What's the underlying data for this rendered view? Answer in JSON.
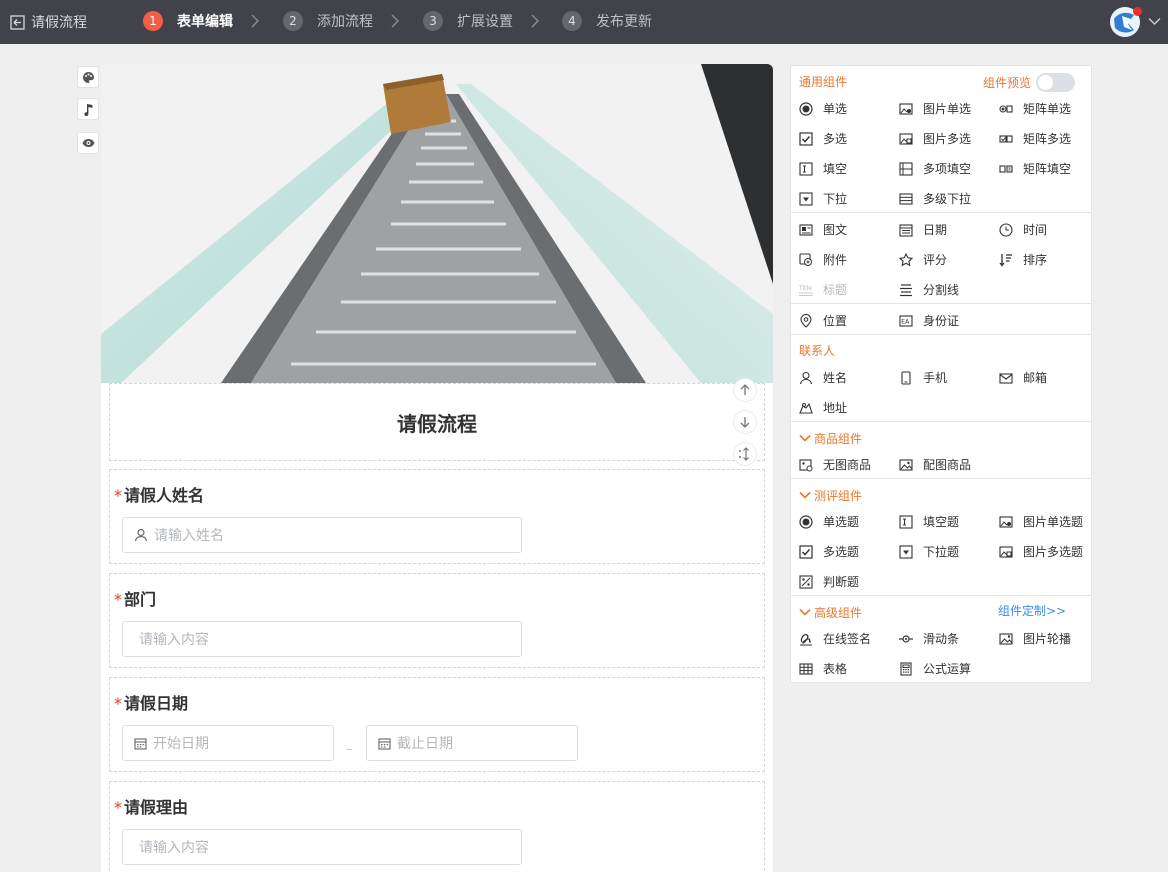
{
  "topbar": {
    "back_label": "请假流程",
    "steps": [
      {
        "num": "1",
        "label": "表单编辑",
        "active": true
      },
      {
        "num": "2",
        "label": "添加流程"
      },
      {
        "num": "3",
        "label": "扩展设置"
      },
      {
        "num": "4",
        "label": "发布更新"
      }
    ],
    "accent": "#f45e49"
  },
  "tools": [
    "palette-icon",
    "music-icon",
    "eye-icon"
  ],
  "form": {
    "title": "请假流程",
    "fields": [
      {
        "label": "请假人姓名",
        "placeholder": "请输入姓名"
      },
      {
        "label": "部门",
        "placeholder": "请输入内容"
      },
      {
        "label": "请假日期",
        "start_placeholder": "开始日期",
        "end_placeholder": "截止日期",
        "separator": "–"
      },
      {
        "label": "请假理由",
        "placeholder": "请输入内容"
      }
    ],
    "required_mark": "*"
  },
  "panel": {
    "general": {
      "title": "通用组件",
      "preview_label": "组件预览",
      "items": [
        "单选",
        "图片单选",
        "矩阵单选",
        "多选",
        "图片多选",
        "矩阵多选",
        "填空",
        "多项填空",
        "矩阵填空",
        "下拉",
        "多级下拉"
      ]
    },
    "group2": {
      "items": [
        "图文",
        "日期",
        "时间",
        "附件",
        "评分",
        "排序",
        "标题",
        "分割线"
      ]
    },
    "group3": {
      "items": [
        "位置",
        "身份证"
      ]
    },
    "contact": {
      "title": "联系人",
      "items": [
        "姓名",
        "手机",
        "邮箱",
        "地址"
      ]
    },
    "goods": {
      "title": "商品组件",
      "items": [
        "无图商品",
        "配图商品"
      ]
    },
    "eval": {
      "title": "测评组件",
      "items": [
        "单选题",
        "填空题",
        "图片单选题",
        "多选题",
        "下拉题",
        "图片多选题",
        "判断题"
      ]
    },
    "advanced": {
      "title": "高级组件",
      "link": "组件定制>>",
      "items": [
        "在线签名",
        "滑动条",
        "图片轮播",
        "表格",
        "公式运算"
      ]
    },
    "accent": "#e8772e",
    "link_color": "#3a8ee6"
  }
}
